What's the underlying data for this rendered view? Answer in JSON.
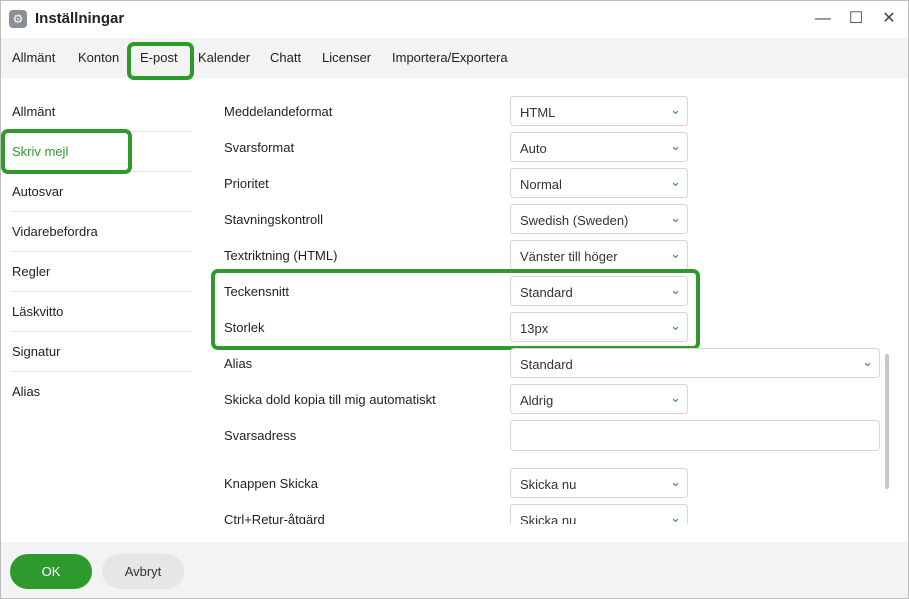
{
  "window": {
    "title": "Inställningar",
    "icon": "gear-icon",
    "minimize_glyph": "—",
    "maximize_glyph": "☐",
    "close_glyph": "✕"
  },
  "tabs": [
    {
      "label": "Allmänt"
    },
    {
      "label": "Konton"
    },
    {
      "label": "E-post",
      "selected": true
    },
    {
      "label": "Kalender"
    },
    {
      "label": "Chatt"
    },
    {
      "label": "Licenser"
    },
    {
      "label": "Importera/Exportera"
    }
  ],
  "sidebar": {
    "items": [
      {
        "label": "Allmänt"
      },
      {
        "label": "Skriv mejl",
        "selected": true
      },
      {
        "label": "Autosvar"
      },
      {
        "label": "Vidarebefordra"
      },
      {
        "label": "Regler"
      },
      {
        "label": "Läskvitto"
      },
      {
        "label": "Signatur"
      },
      {
        "label": "Alias"
      }
    ]
  },
  "settings": [
    {
      "label": "Meddelandeformat",
      "value": "HTML"
    },
    {
      "label": "Svarsformat",
      "value": "Auto"
    },
    {
      "label": "Prioritet",
      "value": "Normal"
    },
    {
      "label": "Stavningskontroll",
      "value": "Swedish (Sweden)"
    },
    {
      "label": "Textriktning (HTML)",
      "value": "Vänster till höger"
    },
    {
      "label": "Teckensnitt",
      "value": "Standard"
    },
    {
      "label": "Storlek",
      "value": "13px"
    },
    {
      "label": "Alias",
      "value": "Standard"
    },
    {
      "label": "Skicka dold kopia till mig automatiskt",
      "value": "Aldrig"
    },
    {
      "label": "Svarsadress",
      "value": ""
    },
    {
      "label": "Knappen Skicka",
      "value": "Skicka nu"
    },
    {
      "label": "Ctrl+Retur-åtgärd",
      "value": "Skicka nu"
    }
  ],
  "chevron_glyph": "⌄",
  "footer": {
    "ok_label": "OK",
    "cancel_label": "Avbryt"
  },
  "colors": {
    "accent": "#2e9a2e",
    "highlight": "#2e9a2e"
  }
}
